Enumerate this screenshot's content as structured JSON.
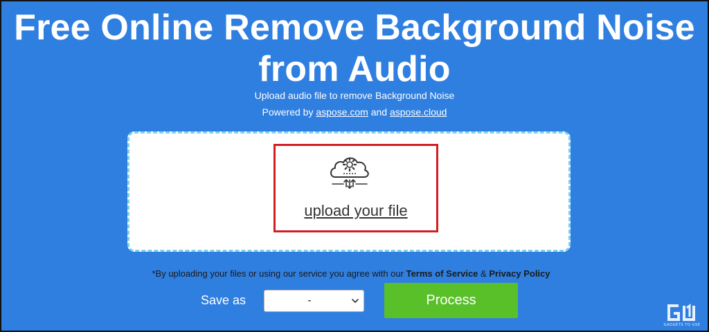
{
  "page": {
    "title": "Free Online Remove Background Noise from Audio",
    "subtitle": "Upload audio file to remove Background Noise",
    "powered_prefix": "Powered by",
    "powered_link_1": "aspose.com",
    "powered_and": "and",
    "powered_link_2": "aspose.cloud"
  },
  "dropzone": {
    "icon": "cloud-gear-upload-icon",
    "upload_label": "upload your file",
    "highlight_color": "#d21d22",
    "border_color": "#7fd0ef"
  },
  "terms": {
    "prefix": "*By uploading your files or using our service you agree with our",
    "tos": "Terms of Service",
    "amp": "&",
    "privacy": "Privacy Policy"
  },
  "controls": {
    "save_as_label": "Save as",
    "format_selected": "-",
    "process_label": "Process",
    "process_color": "#59c02a"
  },
  "watermark": {
    "logo_text": "GU",
    "tagline": "GADGETS TO USE"
  },
  "colors": {
    "background": "#2f7fe1",
    "text": "#ffffff"
  }
}
